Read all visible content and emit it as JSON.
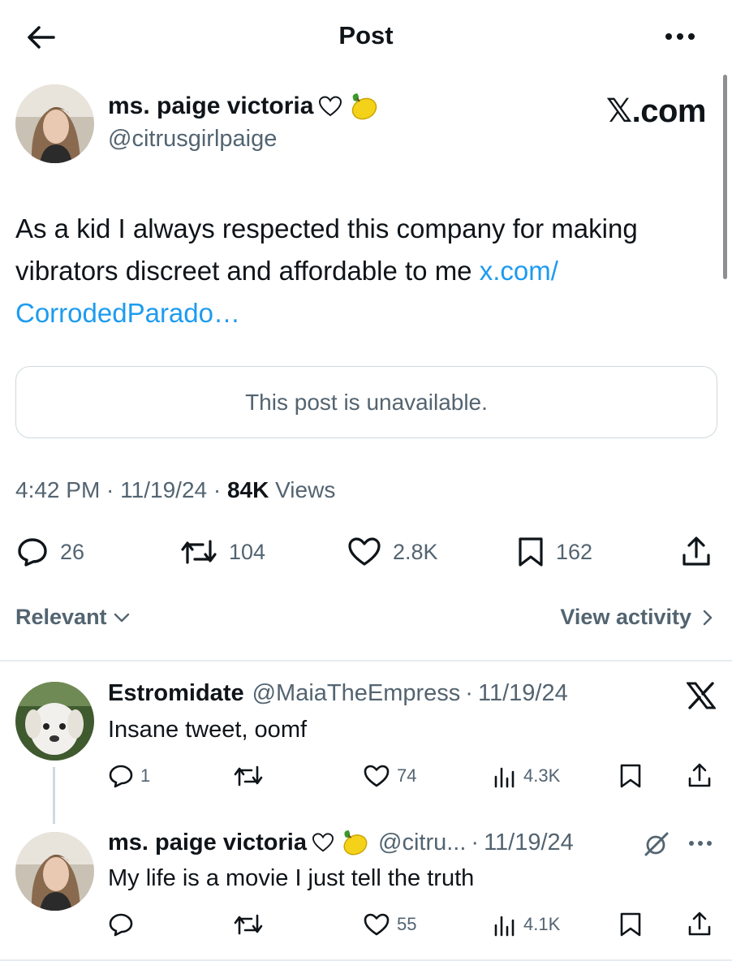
{
  "header": {
    "title": "Post"
  },
  "post": {
    "author": {
      "name": "ms. paige victoria",
      "handle": "@citrusgirlpaige"
    },
    "watermark": "𝕏.com",
    "text": "As a kid I always respected this company for making vibrators discreet and affordable to me ",
    "link_text": "x.com/ CorrodedParado…",
    "quoted_unavailable": "This post is unavailable.",
    "time": "4:42 PM",
    "date": "11/19/24",
    "views_count": "84K",
    "views_label": "Views",
    "stats": {
      "replies": "26",
      "reposts": "104",
      "likes": "2.8K",
      "bookmarks": "162"
    }
  },
  "filter": {
    "sort_label": "Relevant",
    "activity_label": "View activity"
  },
  "replies": [
    {
      "name": "Estromidate",
      "handle": "@MaiaTheEmpress",
      "date": "11/19/24",
      "text": "Insane tweet, oomf",
      "replies": "1",
      "reposts": "",
      "likes": "74",
      "views": "4.3K"
    },
    {
      "name": "ms. paige victoria",
      "handle": "@citru...",
      "date": "11/19/24",
      "text": "My life is a movie I just tell the truth",
      "replies": "",
      "reposts": "",
      "likes": "55",
      "views": "4.1K"
    }
  ],
  "colors": {
    "link": "#1d9bf0",
    "secondary_text": "#536471",
    "primary_text": "#0f1419",
    "border": "#cfd9de"
  },
  "icons": [
    "back-arrow-icon",
    "more-icon",
    "heart-outline-icon",
    "lemon-icon",
    "x-logo-icon",
    "reply-icon",
    "repost-icon",
    "like-icon",
    "bookmark-icon",
    "share-icon",
    "views-icon",
    "chevron-down-icon",
    "chevron-right-icon",
    "grok-icon"
  ]
}
